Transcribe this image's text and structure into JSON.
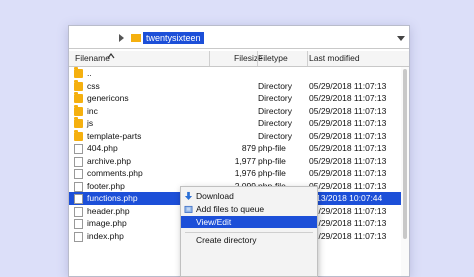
{
  "tree": {
    "node_label": "twentysixteen"
  },
  "columns": {
    "filename": "Filename",
    "filesize": "Filesize",
    "filetype": "Filetype",
    "last_modified": "Last modified"
  },
  "rows": [
    {
      "name": "..",
      "size": "",
      "type": "",
      "modified": "",
      "icon": "folder-icon"
    },
    {
      "name": "css",
      "size": "",
      "type": "Directory",
      "modified": "05/29/2018 11:07:13",
      "icon": "folder-icon"
    },
    {
      "name": "genericons",
      "size": "",
      "type": "Directory",
      "modified": "05/29/2018 11:07:13",
      "icon": "folder-icon"
    },
    {
      "name": "inc",
      "size": "",
      "type": "Directory",
      "modified": "05/29/2018 11:07:13",
      "icon": "folder-icon"
    },
    {
      "name": "js",
      "size": "",
      "type": "Directory",
      "modified": "05/29/2018 11:07:13",
      "icon": "folder-icon"
    },
    {
      "name": "template-parts",
      "size": "",
      "type": "Directory",
      "modified": "05/29/2018 11:07:13",
      "icon": "folder-icon"
    },
    {
      "name": "404.php",
      "size": "879",
      "type": "php-file",
      "modified": "05/29/2018 11:07:13",
      "icon": "file-icon"
    },
    {
      "name": "archive.php",
      "size": "1,977",
      "type": "php-file",
      "modified": "05/29/2018 11:07:13",
      "icon": "file-icon"
    },
    {
      "name": "comments.php",
      "size": "1,976",
      "type": "php-file",
      "modified": "05/29/2018 11:07:13",
      "icon": "file-icon"
    },
    {
      "name": "footer.php",
      "size": "2,099",
      "type": "php-file",
      "modified": "05/29/2018 11:07:13",
      "icon": "file-icon"
    },
    {
      "name": "functions.php",
      "size": "",
      "type": "",
      "modified": "7/13/2018 10:07:44",
      "icon": "file-icon",
      "selected": true
    },
    {
      "name": "header.php",
      "size": "",
      "type": "",
      "modified": "05/29/2018 11:07:13",
      "icon": "file-icon"
    },
    {
      "name": "image.php",
      "size": "",
      "type": "",
      "modified": "05/29/2018 11:07:13",
      "icon": "file-icon"
    },
    {
      "name": "index.php",
      "size": "",
      "type": "",
      "modified": "05/29/2018 11:07:13",
      "icon": "file-icon"
    }
  ],
  "context_menu": {
    "download": "Download",
    "add_to_queue": "Add files to queue",
    "view_edit": "View/Edit",
    "create_directory": "Create directory"
  },
  "colors": {
    "selection": "#1c4fd8",
    "folder": "#f5b00f",
    "background": "#dcdff9"
  }
}
